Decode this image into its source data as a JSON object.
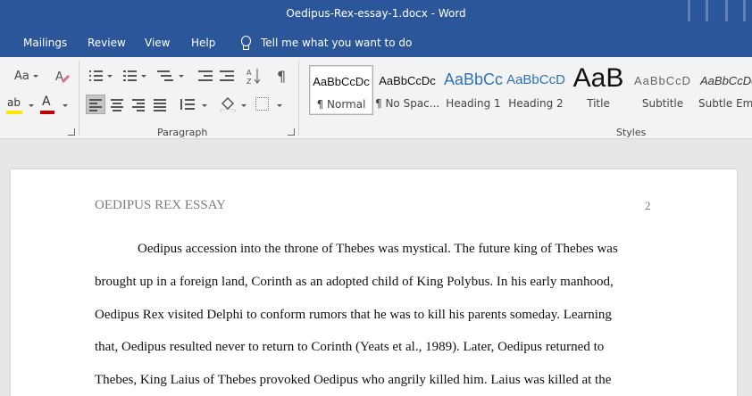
{
  "window": {
    "title": "Oedipus-Rex-essay-1.docx  -  Word"
  },
  "tabs": [
    "Mailings",
    "Review",
    "View",
    "Help"
  ],
  "tell_me": "Tell me what you want to do",
  "ribbon": {
    "font_size_label": "Aa",
    "paragraph_label": "Paragraph",
    "styles_label": "Styles",
    "pilcrow": "¶",
    "text_color_letter": "A",
    "highlight_letters": "ab",
    "colors": {
      "accent": "#2b579a",
      "highlight": "#ffe600",
      "font_color": "#c00000"
    }
  },
  "styles": [
    {
      "preview": "AaBbCcDc",
      "name": "¶ Normal",
      "selected": true
    },
    {
      "preview": "AaBbCcDc",
      "name": "¶ No Spac..."
    },
    {
      "preview": "AaBbCc",
      "name": "Heading 1"
    },
    {
      "preview": "AaBbCcD",
      "name": "Heading 2"
    },
    {
      "preview": "AaB",
      "name": "Title"
    },
    {
      "preview": "AaBbCcD",
      "name": "Subtitle"
    },
    {
      "preview": "AaBbCcDc",
      "name": "Subtle Em..."
    }
  ],
  "document": {
    "header": "OEDIPUS REX ESSAY",
    "page_number": "2",
    "lines": [
      "Oedipus accession into the throne of Thebes was mystical. The future king of Thebes was",
      "brought up in a foreign land, Corinth as an adopted child of King Polybus. In his early manhood,",
      "Oedipus Rex visited Delphi to conform rumors that he was to kill his parents someday. Learning",
      "that, Oedipus resulted never to return to Corinth (Yeats et al., 1989). Later, Oedipus returned to",
      "Thebes, King Laius of Thebes provoked Oedipus who angrily killed him. Laius was killed at the"
    ]
  }
}
